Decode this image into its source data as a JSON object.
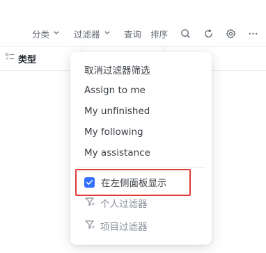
{
  "toolbar": {
    "group_label": "分类",
    "filter_label": "过滤器",
    "query_label": "查询",
    "sort_label": "排序",
    "icons": [
      "search-icon",
      "refresh-icon",
      "gear-icon",
      "more-icon"
    ]
  },
  "table": {
    "type_column_label": "类型",
    "type_column_icon": "list-icon"
  },
  "filter_menu": {
    "items": [
      {
        "label": "取消过滤器筛选"
      },
      {
        "label": "Assign to me"
      },
      {
        "label": "My unfinished"
      },
      {
        "label": "My following"
      },
      {
        "label": "My assistance"
      }
    ],
    "show_in_sidebar": {
      "label": "在左侧面板显示",
      "checked": true
    },
    "personal_filters_label": "个人过滤器",
    "project_filters_label": "项目过滤器"
  },
  "colors": {
    "accent": "#3370ff",
    "highlight_border": "#e23b36",
    "text_secondary": "#646a73"
  }
}
